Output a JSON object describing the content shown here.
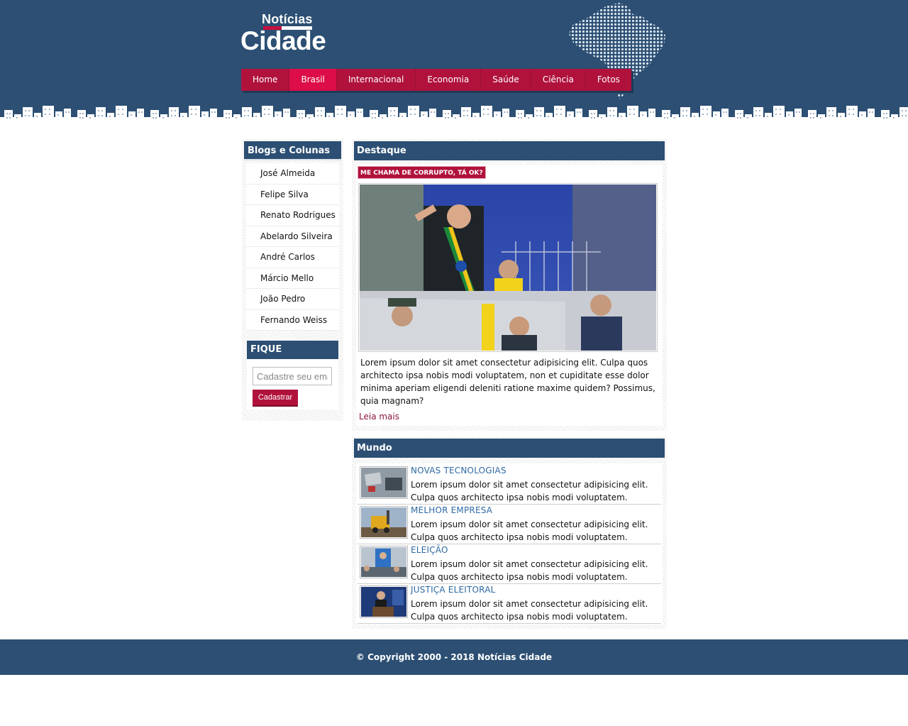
{
  "brand": {
    "small": "Notícias",
    "big": "Cidade",
    "colors": {
      "navy": "#2c4f73",
      "red": "#b0123c",
      "active": "#dc0d48"
    }
  },
  "nav": {
    "items": [
      {
        "label": "Home",
        "active": false
      },
      {
        "label": "Brasil",
        "active": true
      },
      {
        "label": "Internacional",
        "active": false
      },
      {
        "label": "Economia",
        "active": false
      },
      {
        "label": "Saúde",
        "active": false
      },
      {
        "label": "Ciência",
        "active": false
      },
      {
        "label": "Fotos",
        "active": false
      }
    ]
  },
  "sidebar": {
    "title": "Blogs e Colunas",
    "items": [
      "José Almeida",
      "Felipe Silva",
      "Renato Rodrigues",
      "Abelardo Silveira",
      "André Carlos",
      "Márcio Mello",
      "João Pedro",
      "Fernando Weiss"
    ],
    "newsletter": {
      "title": "FIQUE ATUALIZADO",
      "placeholder": "Cadastre seu email",
      "button": "Cadastrar"
    }
  },
  "destaque": {
    "title": "Destaque",
    "tag": "ME CHAMA DE CORRUPTO, TÁ OK?",
    "photo_icon": "parade-photo",
    "text": "Lorem ipsum dolor sit amet consectetur adipisicing elit. Culpa quos architecto ipsa nobis modi voluptatem, non et cupiditate esse dolor minima aperiam eligendi deleniti ratione maxime quidem? Possimus, quia magnam?",
    "more": "Leia mais"
  },
  "mundo": {
    "title": "Mundo",
    "items": [
      {
        "title": "NOVAS TECNOLOGIAS",
        "text": "Lorem ipsum dolor sit amet consectetur adipisicing elit. Culpa quos architecto ipsa nobis modi voluptatem.",
        "thumb": "desk-photo"
      },
      {
        "title": "MELHOR EMPRESA",
        "text": "Lorem ipsum dolor sit amet consectetur adipisicing elit. Culpa quos architecto ipsa nobis modi voluptatem.",
        "thumb": "construction-photo"
      },
      {
        "title": "ELEIÇÃO",
        "text": "Lorem ipsum dolor sit amet consectetur adipisicing elit. Culpa quos architecto ipsa nobis modi voluptatem.",
        "thumb": "rally-photo"
      },
      {
        "title": "JUSTIÇA ELEITORAL",
        "text": "Lorem ipsum dolor sit amet consectetur adipisicing elit. Culpa quos architecto ipsa nobis modi voluptatem.",
        "thumb": "speaker-photo"
      }
    ]
  },
  "footer": {
    "text": "© Copyright 2000 - 2018 Notícias Cidade"
  }
}
